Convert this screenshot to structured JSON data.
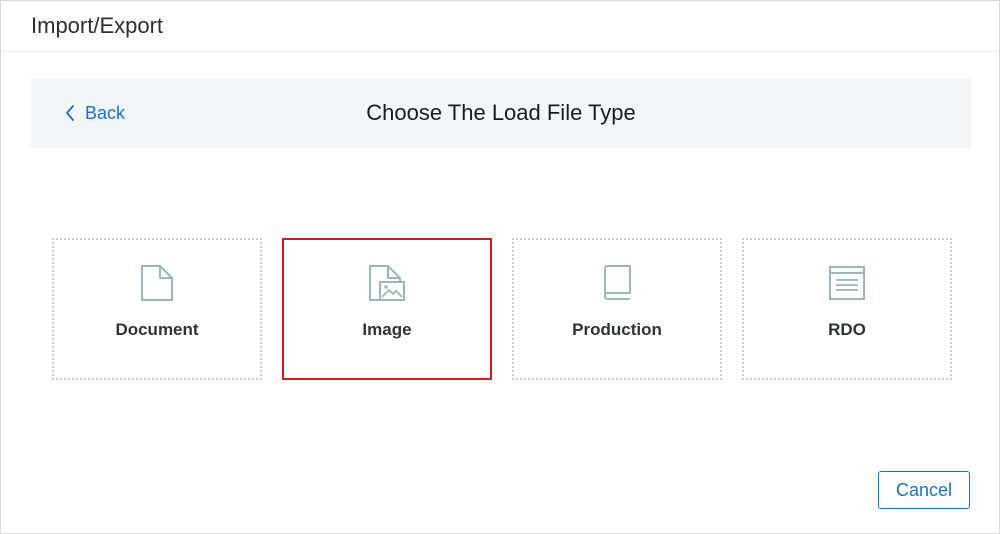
{
  "dialog": {
    "title": "Import/Export"
  },
  "step_bar": {
    "back_label": "Back",
    "title": "Choose The Load File Type"
  },
  "tiles": [
    {
      "label": "Document",
      "icon": "document-icon",
      "selected": false
    },
    {
      "label": "Image",
      "icon": "image-file-icon",
      "selected": true
    },
    {
      "label": "Production",
      "icon": "book-icon",
      "selected": false
    },
    {
      "label": "RDO",
      "icon": "list-window-icon",
      "selected": false
    }
  ],
  "footer": {
    "cancel_label": "Cancel"
  },
  "colors": {
    "accent": "#1d6fc4",
    "selection_border": "#c8201f",
    "icon_stroke": "#9ab6bf",
    "step_bar_bg": "#f2f6f9"
  }
}
